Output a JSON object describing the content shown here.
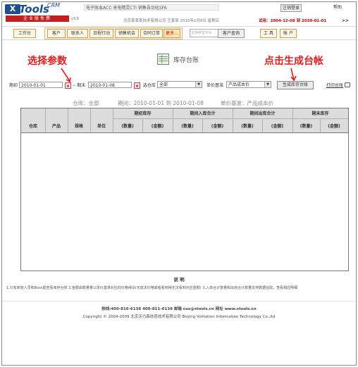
{
  "header": {
    "logo_x": "X",
    "logo_name": "Tools",
    "logo_crm": "CRM",
    "logo_tagline": "企业版免费",
    "logo_version": "v3.5",
    "ticker": "电子账本ACC  来电精灵CTI  销售自动化SFA",
    "login_button": "注销登录",
    "help_link": "帮助",
    "company_line": "北京某某某技术有限公司  王某某  2010年1月8日 星期五",
    "trial_text": "试用：2004-12-08 到 2030-01-01",
    "more_icon": ">>"
  },
  "nav": {
    "workbench": "工作台",
    "tabs": [
      "客户",
      "联系人",
      "日程行动",
      "销售机会",
      "合同订单",
      "更多..."
    ],
    "search_placeholder": "支持拼音字头",
    "search_button": "客户查询",
    "tools": "工 具",
    "account": "帐 户"
  },
  "annotations": {
    "left": "选择参数",
    "right": "点击生成台帐"
  },
  "page": {
    "title": "库存台账",
    "title_icon": "ledger-icon"
  },
  "form": {
    "period_label": "期初",
    "start_date": "2010-01-01",
    "to_label": "-- 期末",
    "end_date": "2010-01-08",
    "warehouse_label": "选仓库",
    "warehouse_value": "全部",
    "price_label": "单价基准",
    "price_value": "产品成本价",
    "generate_button": "生成库存台账",
    "print_link": "打印台账"
  },
  "summary": {
    "warehouse_text": "仓库：全部",
    "period_text": "期间：2010-01-01 到 2010-01-08",
    "price_text": "单价基准：产品成本价"
  },
  "table": {
    "fixed_headers": [
      "仓库",
      "产品",
      "规格",
      "单位"
    ],
    "groups": [
      "期初库存",
      "期间入库合计",
      "期间出库合计",
      "期末库存"
    ],
    "sub_headers": [
      "(数量)",
      "(金额)"
    ]
  },
  "notes": {
    "title": "说  明",
    "text": "1.只有库管人员和Boss能查看库存台帐  2.金额由数量乘以单价基准对应的价格得出(无成本价格或者看到得无法看到对应金额) 3.入库合计数量和出库合计数量支持数据钻取，查看相应明细"
  },
  "footer": {
    "contact": "热线:400-816-6138  400-811-6138  邮箱 cus@xtools.cn  网址 www.xtools.cn",
    "copyright": "Copyright © 2004-2009  北京沃力森信息技术有限公司  Beijing Volitation Information Technology Co.,ltd"
  },
  "colors": {
    "brand_blue": "#1b4f8f",
    "annotation_red": "#e02020",
    "nav_orange": "#d99a4a",
    "table_header": "#dcdcdc"
  }
}
